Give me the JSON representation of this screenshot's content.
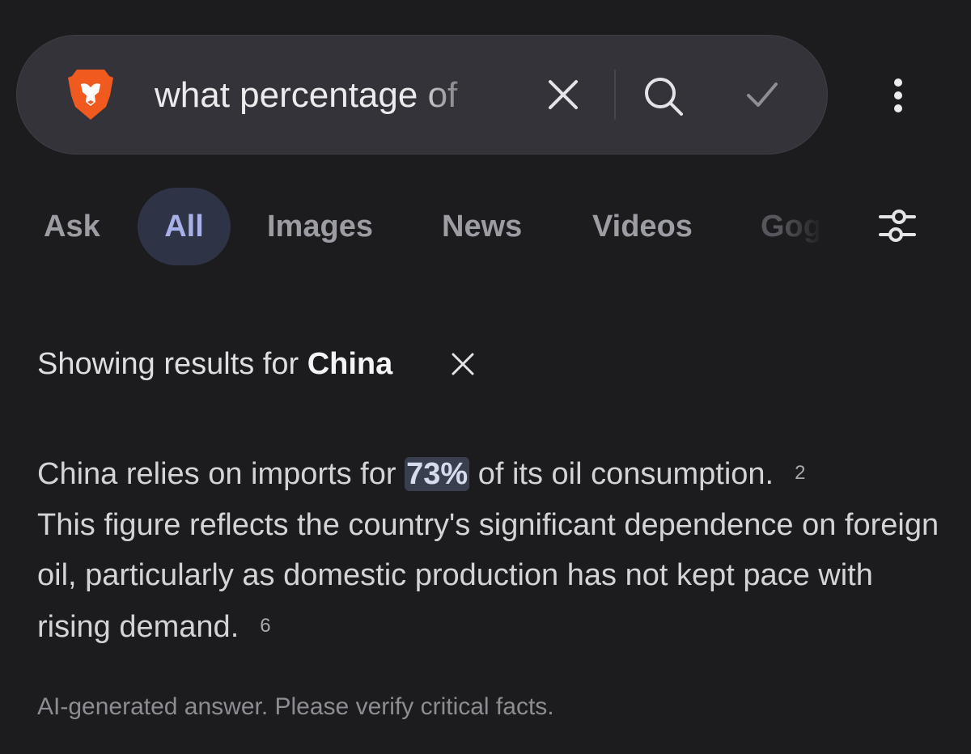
{
  "search": {
    "query": "what percentage of",
    "logo_icon": "brave-lion-icon",
    "clear_icon": "close-icon",
    "search_icon": "search-icon",
    "submit_icon": "check-icon",
    "menu_icon": "more-vertical-icon"
  },
  "tabs": [
    {
      "label": "Ask",
      "active": false
    },
    {
      "label": "All",
      "active": true
    },
    {
      "label": "Images",
      "active": false
    },
    {
      "label": "News",
      "active": false
    },
    {
      "label": "Videos",
      "active": false
    },
    {
      "label": "Goggles",
      "active": false
    }
  ],
  "filter_icon": "filter-sliders-icon",
  "showing": {
    "prefix": "Showing results for",
    "term": "China",
    "close_icon": "close-icon"
  },
  "answer": {
    "part1": "China relies on imports for",
    "highlight": "73%",
    "part2": "of its oil consumption.",
    "cite1": "2",
    "part3": "This figure reflects the country's significant dependence on foreign oil, particularly as domestic production has not kept pace with rising demand.",
    "cite2": "6"
  },
  "disclaimer": "AI-generated answer. Please verify critical facts.",
  "colors": {
    "background": "#1c1c1e",
    "search_bar": "#333339",
    "brand_orange": "#f05a1e",
    "active_tab_bg": "#2f3346",
    "active_tab_text": "#a8b0e8",
    "highlight_bg": "#3a3f50"
  }
}
